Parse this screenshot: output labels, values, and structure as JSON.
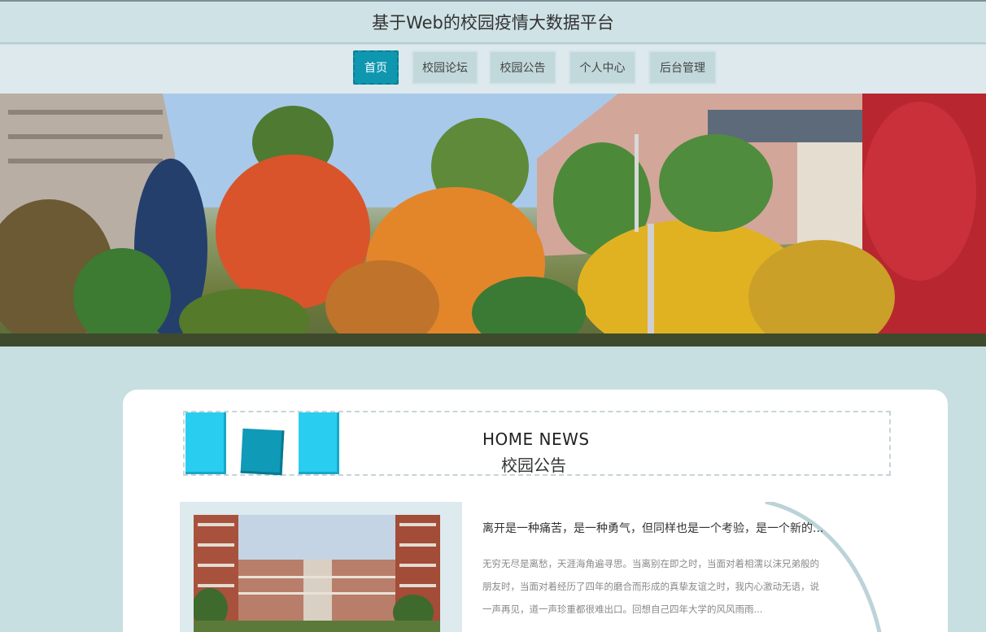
{
  "header": {
    "title": "基于Web的校园疫情大数据平台"
  },
  "nav": {
    "items": [
      {
        "label": "首页",
        "active": true
      },
      {
        "label": "校园论坛",
        "active": false
      },
      {
        "label": "校园公告",
        "active": false
      },
      {
        "label": "个人中心",
        "active": false
      },
      {
        "label": "后台管理",
        "active": false
      }
    ]
  },
  "banner": {
    "alt_icon": "campus-autumn-photo"
  },
  "news_section": {
    "heading_en": "HOME NEWS",
    "heading_cn": "校园公告",
    "items": [
      {
        "title": "离开是一种痛苦，是一种勇气，但同样也是一个考验，是一个新的...",
        "summary": "无穷无尽是离愁，天涯海角遍寻思。当离别在即之时，当面对着相濡以沫兄弟般的朋友时，当面对着经历了四年的磨合而形成的真挚友谊之时，我内心激动无语，说一声再见，道一声珍重都很难出口。回想自己四年大学的风风雨雨..."
      }
    ]
  },
  "colors": {
    "accent": "#0f97b0",
    "background": "#c8dfe2",
    "deco_light": "#29cdf0",
    "deco_dark": "#0f9ab8"
  }
}
